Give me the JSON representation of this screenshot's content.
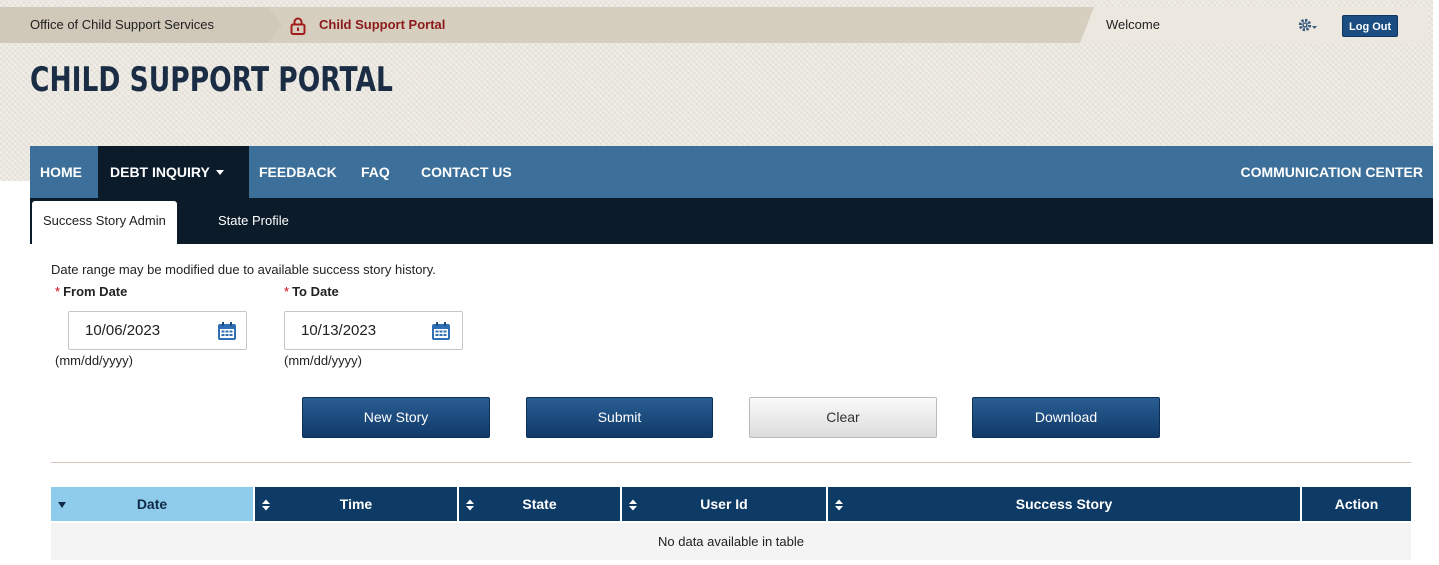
{
  "breadcrumb": {
    "org": "Office of Child Support Services",
    "portal": "Child Support Portal"
  },
  "header": {
    "welcome": "Welcome",
    "logout_label": "Log Out",
    "title": "CHILD SUPPORT PORTAL"
  },
  "nav": {
    "items": [
      {
        "label": "HOME"
      },
      {
        "label": "DEBT INQUIRY",
        "active": true,
        "has_dropdown": true
      },
      {
        "label": "FEEDBACK"
      },
      {
        "label": "FAQ"
      },
      {
        "label": "CONTACT US"
      }
    ],
    "right_label": "COMMUNICATION CENTER"
  },
  "subnav": {
    "tabs": [
      {
        "label": "Success Story Admin",
        "active": true
      },
      {
        "label": "State Profile"
      }
    ]
  },
  "form": {
    "hint": "Date range may be modified due to available success story history.",
    "from_label": "From Date",
    "from_value": "10/06/2023",
    "to_label": "To Date",
    "to_value": "10/13/2023",
    "format_hint": "(mm/dd/yyyy)",
    "required_mark": "*"
  },
  "buttons": {
    "new_story": "New Story",
    "submit": "Submit",
    "clear": "Clear",
    "download": "Download"
  },
  "table": {
    "columns": [
      {
        "label": "Date",
        "sorted": true
      },
      {
        "label": "Time"
      },
      {
        "label": "State"
      },
      {
        "label": "User Id"
      },
      {
        "label": "Success Story"
      },
      {
        "label": "Action"
      }
    ],
    "empty_message": "No data available in table"
  },
  "colors": {
    "nav_bg": "#3c6f99",
    "nav_active": "#0c1b2a",
    "button_primary": "#1b4d82",
    "table_header": "#0e3a66",
    "sorted_header": "#8fcbea",
    "brand_red": "#8b1a1a"
  },
  "icons": {
    "lock": "lock-icon",
    "gear": "gear-icon",
    "calendar": "calendar-icon",
    "sort": "sort-icon"
  }
}
